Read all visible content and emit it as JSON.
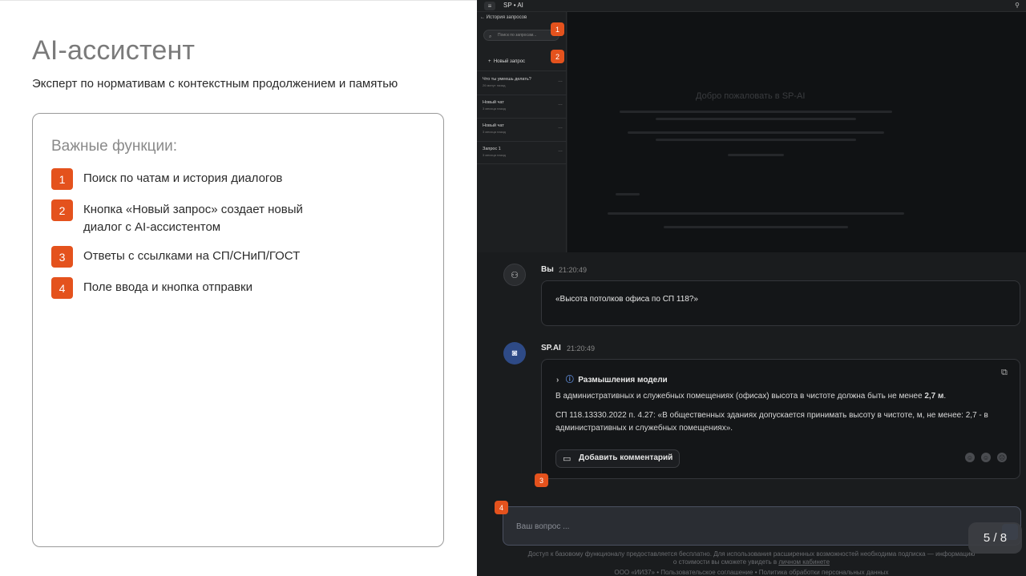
{
  "slide": {
    "title": "AI-ассистент",
    "subtitle": "Эксперт по нормативам с контекстным продолжением и памятью",
    "card_title": "Важные функции:",
    "features": [
      {
        "num": "1",
        "text": "Поиск по чатам и история диалогов"
      },
      {
        "num": "2",
        "text": "Кнопка «Новый запрос» создает новый диалог с AI-ассистентом"
      },
      {
        "num": "3",
        "text": "Ответы с ссылками на СП/СНиП/ГОСТ"
      },
      {
        "num": "4",
        "text": "Поле ввода и кнопка отправки"
      }
    ],
    "pager": "5 / 8",
    "accent": "#e4521d"
  },
  "app": {
    "title": "SP • AI",
    "menu_icon": "menu-icon",
    "user_icon": "user-icon",
    "sidebar": {
      "header": "История запросов",
      "search_placeholder": "Поиск по запросам...",
      "new_request": "Новый запрос",
      "items": [
        {
          "title": "Что ты умеешь делать?",
          "subtitle": "26 минут назад"
        },
        {
          "title": "Новый чат",
          "subtitle": "3 месяца назад"
        },
        {
          "title": "Новый чат",
          "subtitle": "3 месяца назад"
        },
        {
          "title": "Запрос 1",
          "subtitle": "3 месяца назад"
        }
      ]
    },
    "welcome_title": "Добро пожаловать в SP-AI",
    "chat": {
      "user_name": "Вы",
      "user_time": "21:20:49",
      "user_message": "«Высота потолков офиса по СП 118?»",
      "bot_name": "SP.AI",
      "bot_time": "21:20:49",
      "thinking_label": "Размышления модели",
      "answer_prefix": "В административных и служебных помещениях (офисах) высота в чистоте должна быть не менее ",
      "answer_bold": "2,7 м",
      "answer_suffix": ".",
      "citation": "СП 118.13330.2022 п. 4.27: «В общественных зданиях допускается принимать высоту в чистоте, м, не менее: 2,7 - в административных и служебных помещениях».",
      "comment_button": "Добавить комментарий"
    },
    "input_placeholder": "Ваш вопрос ...",
    "footer_line1": "Доступ к базовому функционалу предоставляется бесплатно. Для использования расширенных возможностей необходима подписка — информацию",
    "footer_line2_prefix": "о стоимости вы сможете увидеть в ",
    "footer_line2_link": "личном кабинете",
    "footer_line3": "ООО «ИИЗ7» • Пользовательское соглашение • Политика обработки персональных данных",
    "badges": [
      "1",
      "2",
      "3",
      "4"
    ]
  }
}
